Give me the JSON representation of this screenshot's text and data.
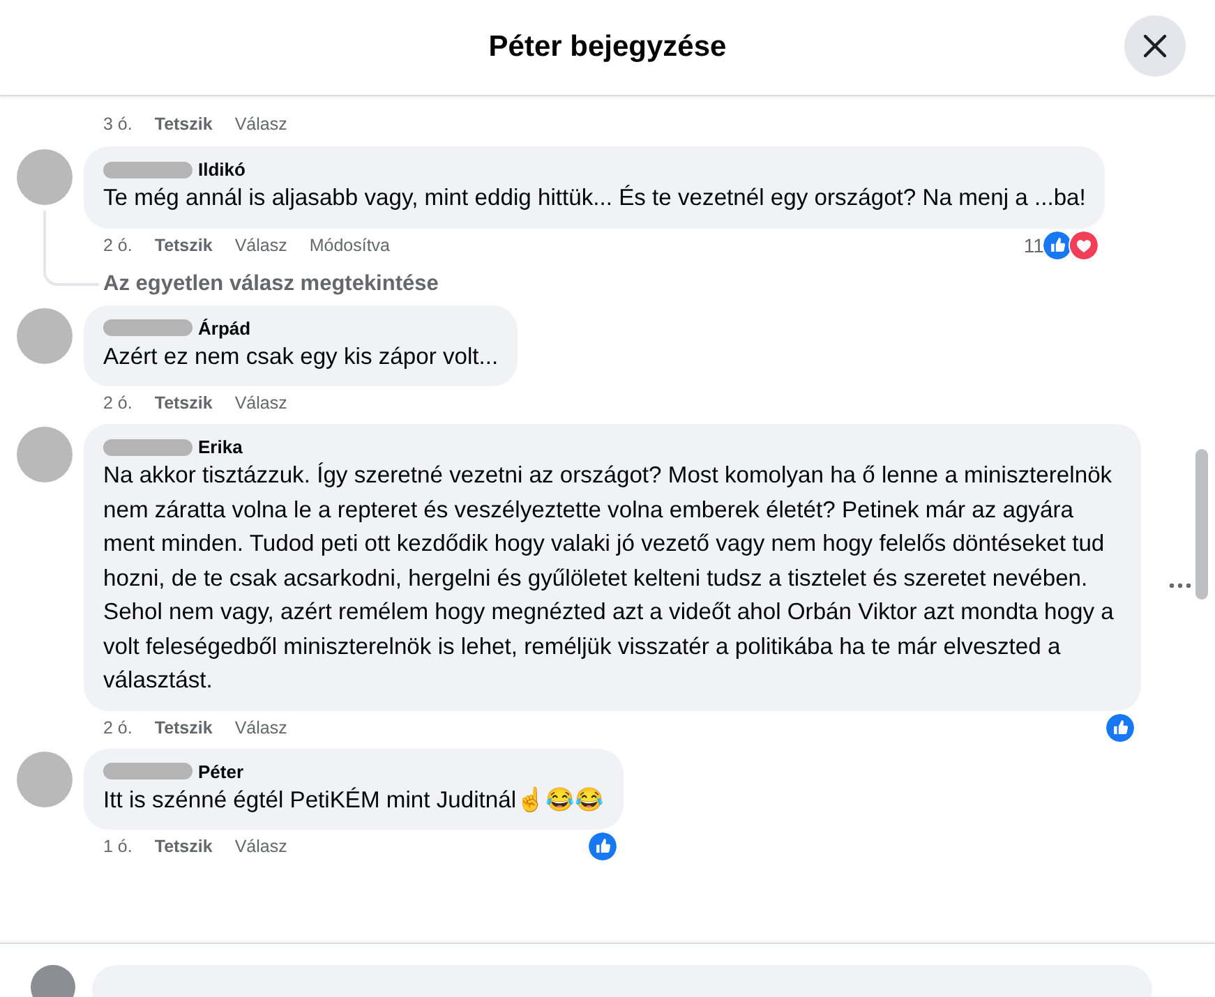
{
  "dialog": {
    "title": "Péter bejegyzése"
  },
  "previous_actions": {
    "time": "3 ó.",
    "actions": [
      "Tetszik",
      "Válasz"
    ]
  },
  "comments": [
    {
      "author": "Ildikó",
      "text": "Te még annál is aljasabb vagy, mint eddig hittük... És te vezetnél egy országot? Na menj a ...ba!",
      "time": "2 ó.",
      "actions": [
        "Tetszik",
        "Válasz",
        "Módosítva"
      ],
      "reaction_count": "11",
      "reactions": [
        {
          "kind": "like"
        },
        {
          "kind": "love"
        }
      ],
      "view_replies": "Az egyetlen válasz megtekintése",
      "more_menu": false
    },
    {
      "author": "Árpád",
      "text": "Azért ez nem csak egy kis zápor volt...",
      "time": "2 ó.",
      "actions": [
        "Tetszik",
        "Válasz"
      ],
      "more_menu": false
    },
    {
      "author": "Erika",
      "text": "Na akkor tisztázzuk. Így szeretné vezetni az országot? Most komolyan ha ő lenne a miniszterelnök nem záratta volna le a repteret és veszélyeztette volna emberek életét? Petinek már az agyára ment minden. Tudod peti ott kezdődik hogy valaki jó vezető vagy nem hogy felelős döntéseket tud hozni, de te csak acsarkodni, hergelni és gyűlöletet kelteni tudsz a tisztelet és szeretet nevében. Sehol nem vagy, azért remélem hogy megnézted azt a videőt ahol Orbán Viktor azt mondta hogy a volt feleségedből miniszterelnök is lehet, reméljük visszatér a politikába ha te már elveszted a választást.",
      "time": "2 ó.",
      "actions": [
        "Tetszik",
        "Válasz"
      ],
      "reactions": [
        {
          "kind": "like"
        }
      ],
      "more_menu": true
    },
    {
      "author": "Péter",
      "text": "Itt is szénné égtél PetiKÉM mint Juditnál☝😂😂",
      "time": "1 ó.",
      "actions": [
        "Tetszik",
        "Válasz"
      ],
      "reactions": [
        {
          "kind": "like"
        }
      ],
      "more_menu": false
    }
  ]
}
